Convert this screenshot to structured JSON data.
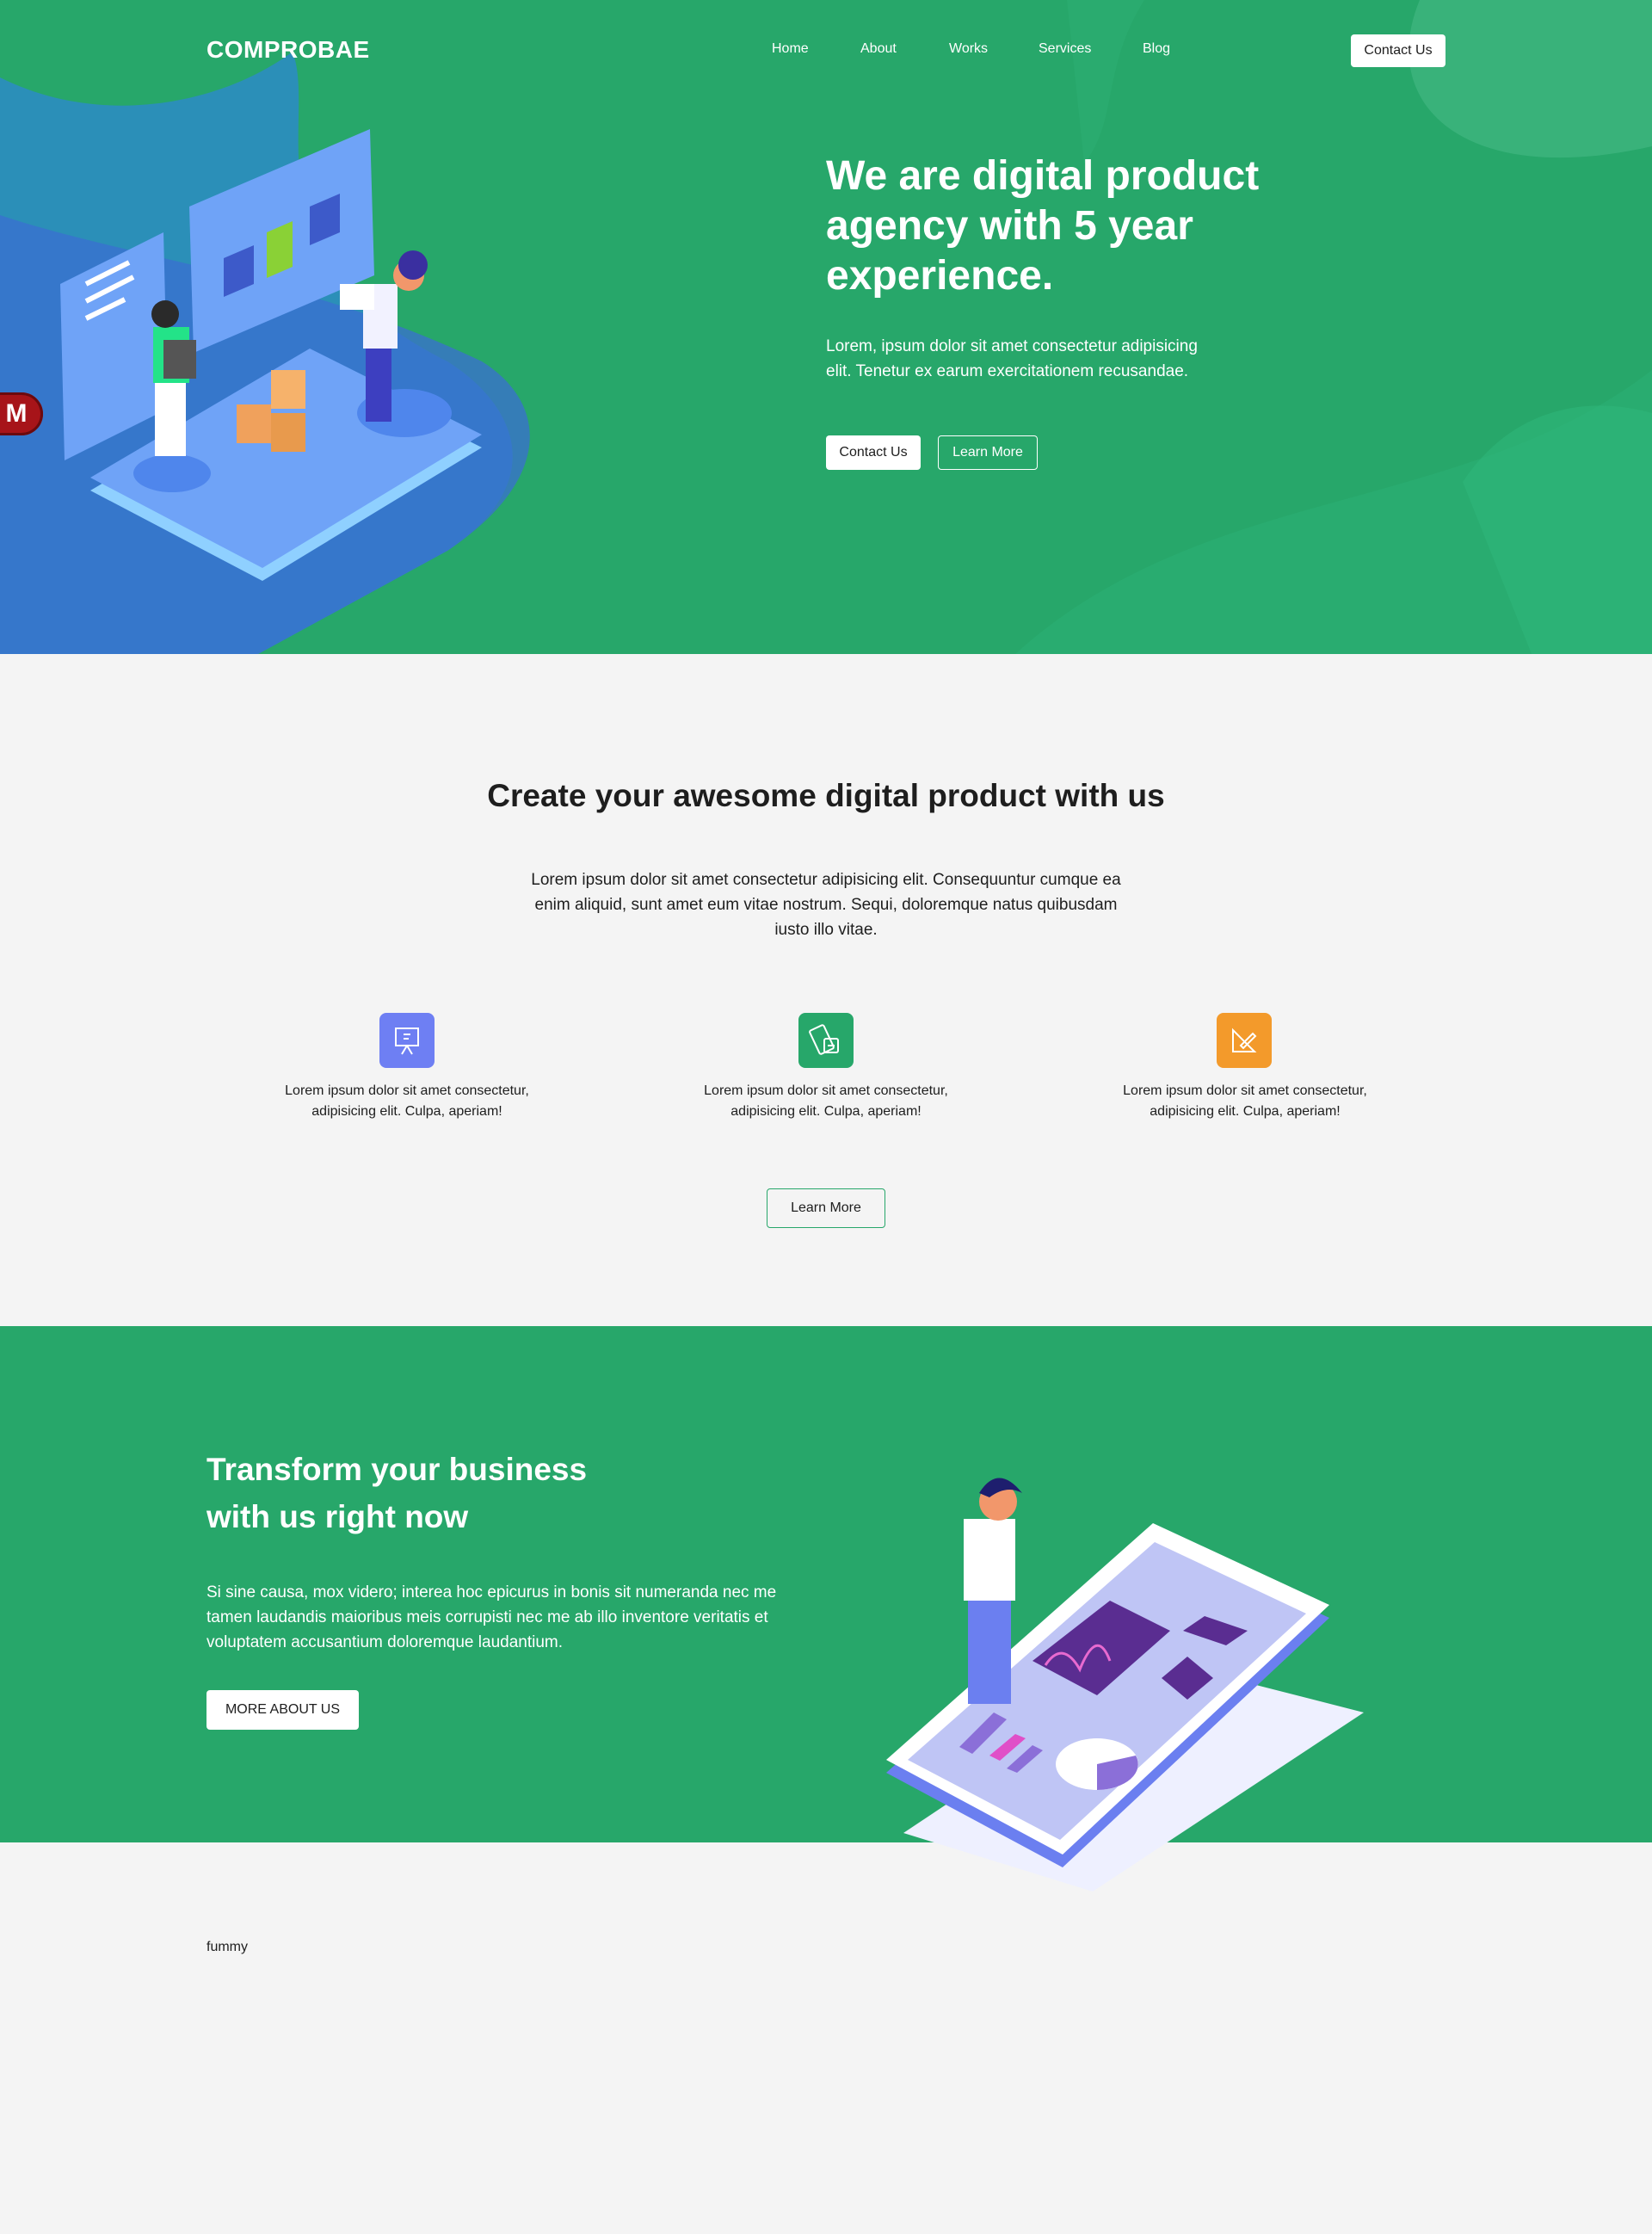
{
  "header": {
    "brand": "COMPROBAE",
    "nav": [
      "Home",
      "About",
      "Works",
      "Services",
      "Blog"
    ],
    "cta": "Contact Us"
  },
  "hero": {
    "title": "We are digital product agency with 5 year experience.",
    "text": "Lorem, ipsum dolor sit amet consectetur adipisicing elit. Tenetur ex earum exercitationem recusandae.",
    "primary_button": "Contact Us",
    "secondary_button": "Learn More"
  },
  "side_badge": {
    "letter": "M"
  },
  "features": {
    "title": "Create your awesome digital product with us",
    "text": "Lorem ipsum dolor sit amet consectetur adipisicing elit. Consequuntur cumque ea enim aliquid, sunt amet eum vitae nostrum. Sequi, doloremque natus quibusdam iusto illo vitae.",
    "items": [
      {
        "icon": "presentation-icon",
        "text": "Lorem ipsum dolor sit amet consectetur, adipisicing elit. Culpa, aperiam!",
        "color": "#6e7ff3"
      },
      {
        "icon": "design-tools-icon",
        "text": "Lorem ipsum dolor sit amet consectetur, adipisicing elit. Culpa, aperiam!",
        "color": "#27a76a"
      },
      {
        "icon": "ruler-pencil-icon",
        "text": "Lorem ipsum dolor sit amet consectetur, adipisicing elit. Culpa, aperiam!",
        "color": "#f39a2b"
      }
    ],
    "button": "Learn More"
  },
  "transform": {
    "title_line1": "Transform your business",
    "title_line2": "with us right now",
    "text": "Si sine causa, mox videro; interea hoc epicurus in bonis sit numeranda nec me tamen laudandis maioribus meis corrupisti nec me ab illo inventore veritatis et voluptatem accusantium doloremque laudantium.",
    "button": "MORE ABOUT US"
  },
  "footer": {
    "text": "fummy"
  },
  "colors": {
    "green": "#27a76a",
    "background": "#f4f4f4",
    "purple": "#5a2d91",
    "blue": "#6b8df5"
  }
}
